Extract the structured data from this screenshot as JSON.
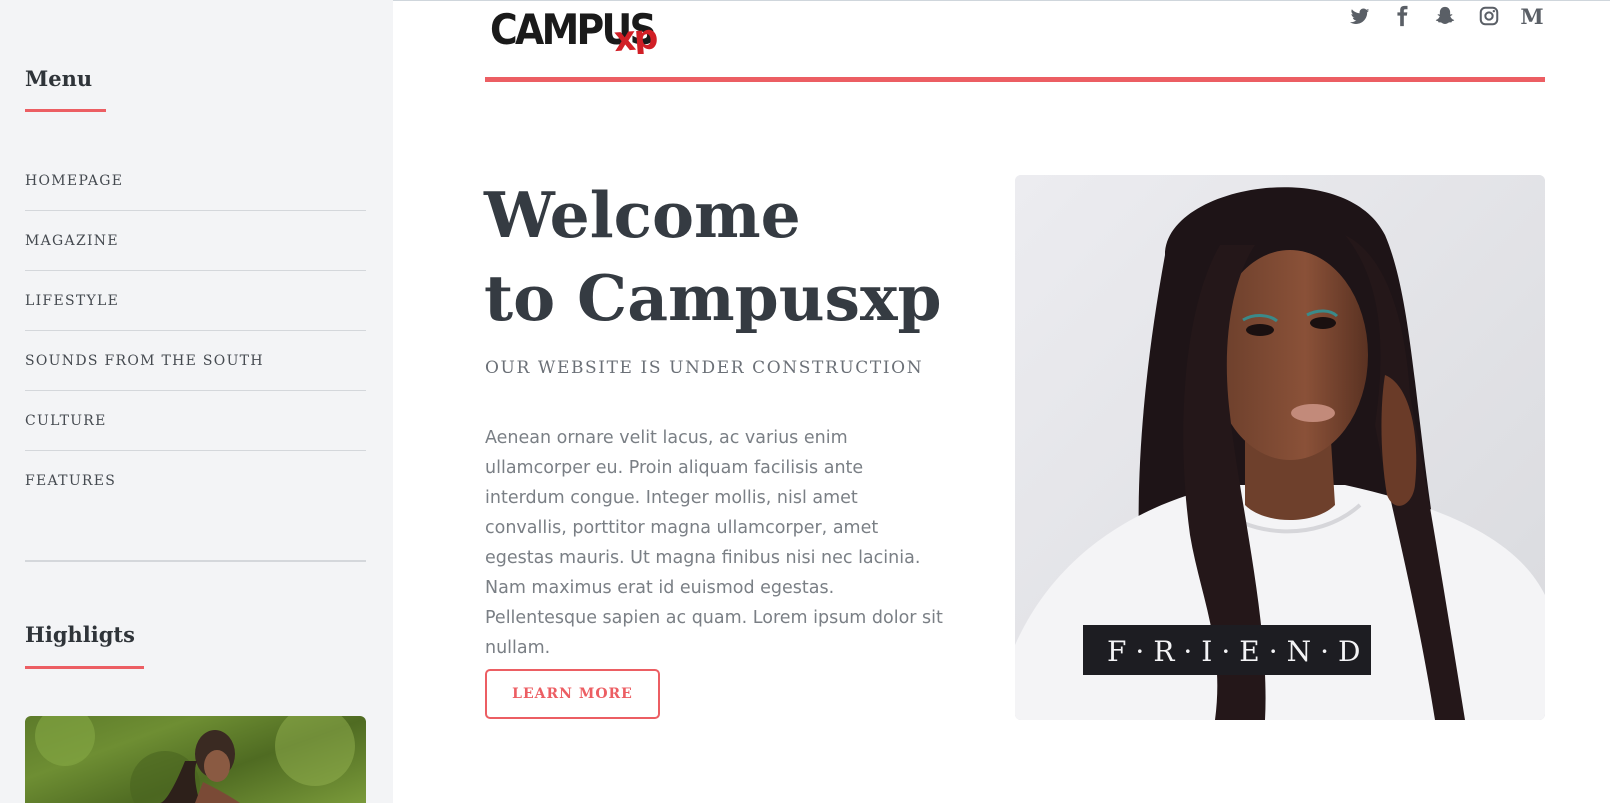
{
  "brand": {
    "logo_text": "CampusXP",
    "accent_color": "#ec5e63"
  },
  "sidebar": {
    "menu_title": "Menu",
    "menu_items": [
      {
        "label": "HOMEPAGE"
      },
      {
        "label": "MAGAZINE"
      },
      {
        "label": "LIFESTYLE"
      },
      {
        "label": "SOUNDS FROM THE SOUTH"
      },
      {
        "label": "CULTURE"
      },
      {
        "label": "FEATURES"
      }
    ],
    "highlights_title": "Highligts"
  },
  "header": {
    "social_icons": [
      "twitter-icon",
      "facebook-icon",
      "snapchat-icon",
      "instagram-icon",
      "medium-icon"
    ],
    "medium_glyph": "M"
  },
  "hero": {
    "title_line1": "Welcome",
    "title_line2": "to Campusxp",
    "subtitle": "OUR WEBSITE IS UNDER CONSTRUCTION",
    "body": "Aenean ornare velit lacus, ac varius enim ullamcorper eu. Proin aliquam facilisis ante interdum congue. Integer mollis, nisl amet convallis, porttitor magna ullamcorper, amet egestas mauris. Ut magna finibus nisi nec lacinia. Nam maximus erat id euismod egestas. Pellentesque sapien ac quam. Lorem ipsum dolor sit nullam.",
    "cta_label": "LEARN MORE",
    "photo_shirt_text": "F·R·I·E·N·D"
  }
}
